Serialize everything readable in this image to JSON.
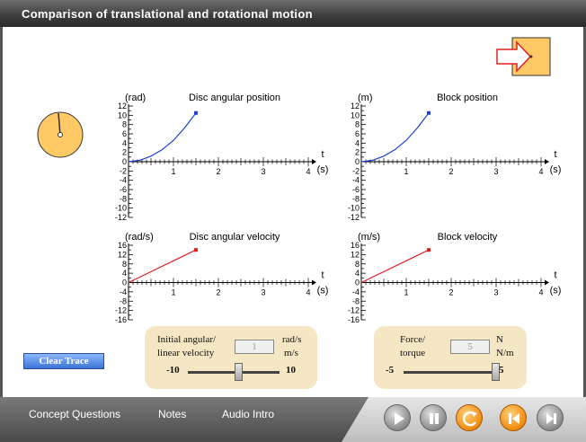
{
  "window": {
    "title": "Comparison of translational and rotational motion"
  },
  "graphs": {
    "disc_position": {
      "title": "Disc angular position",
      "unit": "(rad)"
    },
    "block_position": {
      "title": "Block position",
      "unit": "(m)"
    },
    "disc_velocity": {
      "title": "Disc angular velocity",
      "unit": "(rad/s)"
    },
    "block_velocity": {
      "title": "Block velocity",
      "unit": "(m/s)"
    },
    "x_label": "t",
    "x_unit": "(s)"
  },
  "chart_data": [
    {
      "type": "line",
      "title": "Disc angular position",
      "ylabel": "(rad)",
      "xlabel": "t (s)",
      "xlim": [
        0,
        4
      ],
      "ylim": [
        -12,
        12
      ],
      "x_ticks": [
        "1",
        "2",
        "3",
        "4"
      ],
      "y_ticks": [
        "12",
        "10",
        "8",
        "6",
        "4",
        "2",
        "0",
        "-2",
        "-4",
        "-6",
        "-8",
        "-10",
        "-12"
      ],
      "series": [
        {
          "color": "#1e3fd0",
          "x": [
            0,
            0.25,
            0.5,
            0.75,
            1.0,
            1.25,
            1.5
          ],
          "y": [
            0,
            0.3,
            1.2,
            2.6,
            4.6,
            7.3,
            10.5
          ]
        }
      ]
    },
    {
      "type": "line",
      "title": "Block position",
      "ylabel": "(m)",
      "xlabel": "t (s)",
      "xlim": [
        0,
        4
      ],
      "ylim": [
        -12,
        12
      ],
      "x_ticks": [
        "1",
        "2",
        "3",
        "4"
      ],
      "y_ticks": [
        "12",
        "10",
        "8",
        "6",
        "4",
        "2",
        "0",
        "-2",
        "-4",
        "-6",
        "-8",
        "-10",
        "-12"
      ],
      "series": [
        {
          "color": "#1e3fd0",
          "x": [
            0,
            0.25,
            0.5,
            0.75,
            1.0,
            1.25,
            1.5
          ],
          "y": [
            0,
            0.3,
            1.2,
            2.6,
            4.6,
            7.3,
            10.5
          ]
        }
      ]
    },
    {
      "type": "line",
      "title": "Disc angular velocity",
      "ylabel": "(rad/s)",
      "xlabel": "t (s)",
      "xlim": [
        0,
        4
      ],
      "ylim": [
        -16,
        16
      ],
      "x_ticks": [
        "1",
        "2",
        "3",
        "4"
      ],
      "y_ticks": [
        "16",
        "12",
        "8",
        "4",
        "0",
        "-4",
        "-8",
        "-12",
        "-16"
      ],
      "series": [
        {
          "color": "#e02020",
          "x": [
            0,
            1.5
          ],
          "y": [
            0,
            14
          ]
        }
      ]
    },
    {
      "type": "line",
      "title": "Block velocity",
      "ylabel": "(m/s)",
      "xlabel": "t (s)",
      "xlim": [
        0,
        4
      ],
      "ylim": [
        -16,
        16
      ],
      "x_ticks": [
        "1",
        "2",
        "3",
        "4"
      ],
      "y_ticks": [
        "16",
        "12",
        "8",
        "4",
        "0",
        "-4",
        "-8",
        "-12",
        "-16"
      ],
      "series": [
        {
          "color": "#e02020",
          "x": [
            0,
            1.5
          ],
          "y": [
            0,
            14
          ]
        }
      ]
    }
  ],
  "controls": {
    "velocity": {
      "label_line1": "Initial angular/",
      "label_line2": "linear velocity",
      "unit_line1": "rad/s",
      "unit_line2": "m/s",
      "value": "1",
      "min": "-10",
      "max": "10",
      "level_fraction": 0.55
    },
    "force": {
      "label_line1": "Force/",
      "label_line2": "torque",
      "unit_line1": "N",
      "unit_line2": "N/m",
      "value": "5",
      "min": "-5",
      "max": "5",
      "level_fraction": 1.0
    },
    "clear_trace": "Clear Trace"
  },
  "nav": {
    "concept_questions": "Concept Questions",
    "notes": "Notes",
    "audio_intro": "Audio Intro"
  },
  "icons": {
    "play": "play-icon",
    "pause": "pause-icon",
    "reset": "reset-icon",
    "rewind": "rewind-icon",
    "step": "step-icon"
  },
  "colors": {
    "disc_fill": "#ffc966",
    "block_fill": "#ffc966",
    "arrow_stroke": "#e02020",
    "position_curve": "#1e3fd0",
    "velocity_line": "#e02020",
    "button_blue": "#3b73d8"
  }
}
